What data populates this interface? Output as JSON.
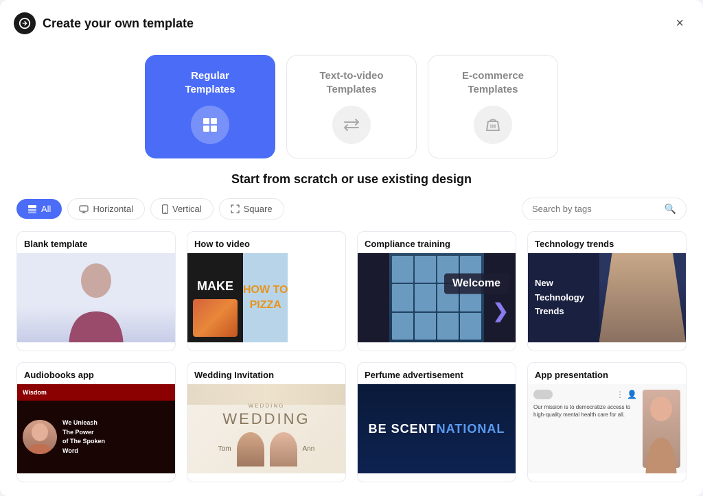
{
  "dialog": {
    "title": "Create your own template",
    "close_label": "×"
  },
  "type_cards": [
    {
      "id": "regular",
      "label": "Regular\nTemplates",
      "icon": "grid-icon",
      "active": true
    },
    {
      "id": "text-to-video",
      "label": "Text-to-video\nTemplates",
      "icon": "swap-icon",
      "active": false
    },
    {
      "id": "ecommerce",
      "label": "E-commerce\nTemplates",
      "icon": "basket-icon",
      "active": false
    }
  ],
  "section_title": "Start from scratch or use existing design",
  "filters": [
    {
      "id": "all",
      "label": "All",
      "icon": "layers-icon",
      "active": true
    },
    {
      "id": "horizontal",
      "label": "Horizontal",
      "icon": "monitor-icon",
      "active": false
    },
    {
      "id": "vertical",
      "label": "Vertical",
      "icon": "phone-icon",
      "active": false
    },
    {
      "id": "square",
      "label": "Square",
      "icon": "square-icon",
      "active": false
    }
  ],
  "search": {
    "placeholder": "Search by tags"
  },
  "templates": [
    {
      "id": "blank",
      "label": "Blank template"
    },
    {
      "id": "howto",
      "label": "How to video"
    },
    {
      "id": "compliance",
      "label": "Compliance training"
    },
    {
      "id": "tech",
      "label": "Technology trends"
    },
    {
      "id": "audiobooks",
      "label": "Audiobooks app"
    },
    {
      "id": "wedding",
      "label": "Wedding Invitation"
    },
    {
      "id": "perfume",
      "label": "Perfume advertisement"
    },
    {
      "id": "app",
      "label": "App presentation"
    }
  ],
  "howto": {
    "make_text": "MAKE",
    "how_to_text": "HOW TO",
    "pizza_text": "PIZZA"
  },
  "compliance": {
    "welcome_text": "Welcome"
  },
  "tech": {
    "words": [
      "New",
      "Technology",
      "Trends"
    ]
  },
  "audio": {
    "header": "Wisdom",
    "body": "We Unleash The Power of The Spoken Word"
  },
  "wedding": {
    "title": "WEDDING",
    "sub": "WEDDiNG",
    "groom": "Tom",
    "bride": "Ann"
  },
  "perfume": {
    "line1": "BE SCENT",
    "line2": "NATIONAL",
    "accent": "NATIONAL"
  },
  "app": {
    "body_text": "Our mission is to democratize access to high-quality mental health care for all."
  }
}
